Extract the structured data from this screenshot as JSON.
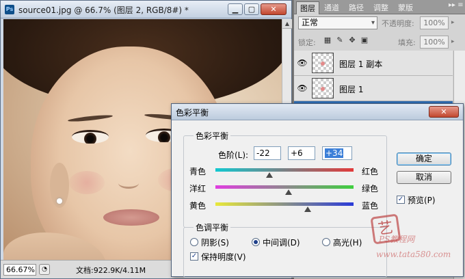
{
  "document": {
    "app_icon": "Ps",
    "title": "source01.jpg @ 66.7% (图层 2, RGB/8#) *",
    "min_glyph": "▁",
    "max_glyph": "▢",
    "close_glyph": "✕",
    "zoom": "66.67%",
    "doc_size": "文档:922.9K/4.11M"
  },
  "layers_panel": {
    "tabs": [
      "图层",
      "通道",
      "路径",
      "调整",
      "蒙版"
    ],
    "active_tab": 0,
    "menu_glyph": "▸▸ ≡",
    "blend_mode": "正常",
    "opacity_label": "不透明度:",
    "opacity_value": "100%",
    "lock_label": "锁定:",
    "lock_icons": [
      "lock-transparent-icon",
      "lock-image-icon",
      "lock-position-icon",
      "lock-all-icon"
    ],
    "fill_label": "填充:",
    "fill_value": "100%",
    "layers": [
      {
        "name": "图层 1 副本",
        "visible": true
      },
      {
        "name": "图层 1",
        "visible": true
      },
      {
        "name": "",
        "visible": true,
        "selected": true
      }
    ]
  },
  "dialog": {
    "title": "色彩平衡",
    "close_glyph": "✕",
    "color_balance_group": "色彩平衡",
    "levels_label": "色阶(L):",
    "levels": [
      "-22",
      "+6",
      "+34"
    ],
    "sliders": [
      {
        "left": "青色",
        "right": "红色",
        "value": -22
      },
      {
        "left": "洋红",
        "right": "绿色",
        "value": 6
      },
      {
        "left": "黄色",
        "right": "蓝色",
        "value": 34
      }
    ],
    "tone_group": "色调平衡",
    "tones": [
      {
        "label": "阴影(S)",
        "checked": false
      },
      {
        "label": "中间调(D)",
        "checked": true
      },
      {
        "label": "高光(H)",
        "checked": false
      }
    ],
    "preserve_luminosity": "保持明度(V)",
    "ok": "确定",
    "cancel": "取消",
    "preview": "预览(P)"
  },
  "watermark": {
    "seal": "艺",
    "ps_text": "PS教程网",
    "url": "www.tata580.com"
  },
  "colors": {
    "selection": "#2f6db3",
    "ok_border": "#3c7fb1",
    "close_red": "#c2472f"
  }
}
